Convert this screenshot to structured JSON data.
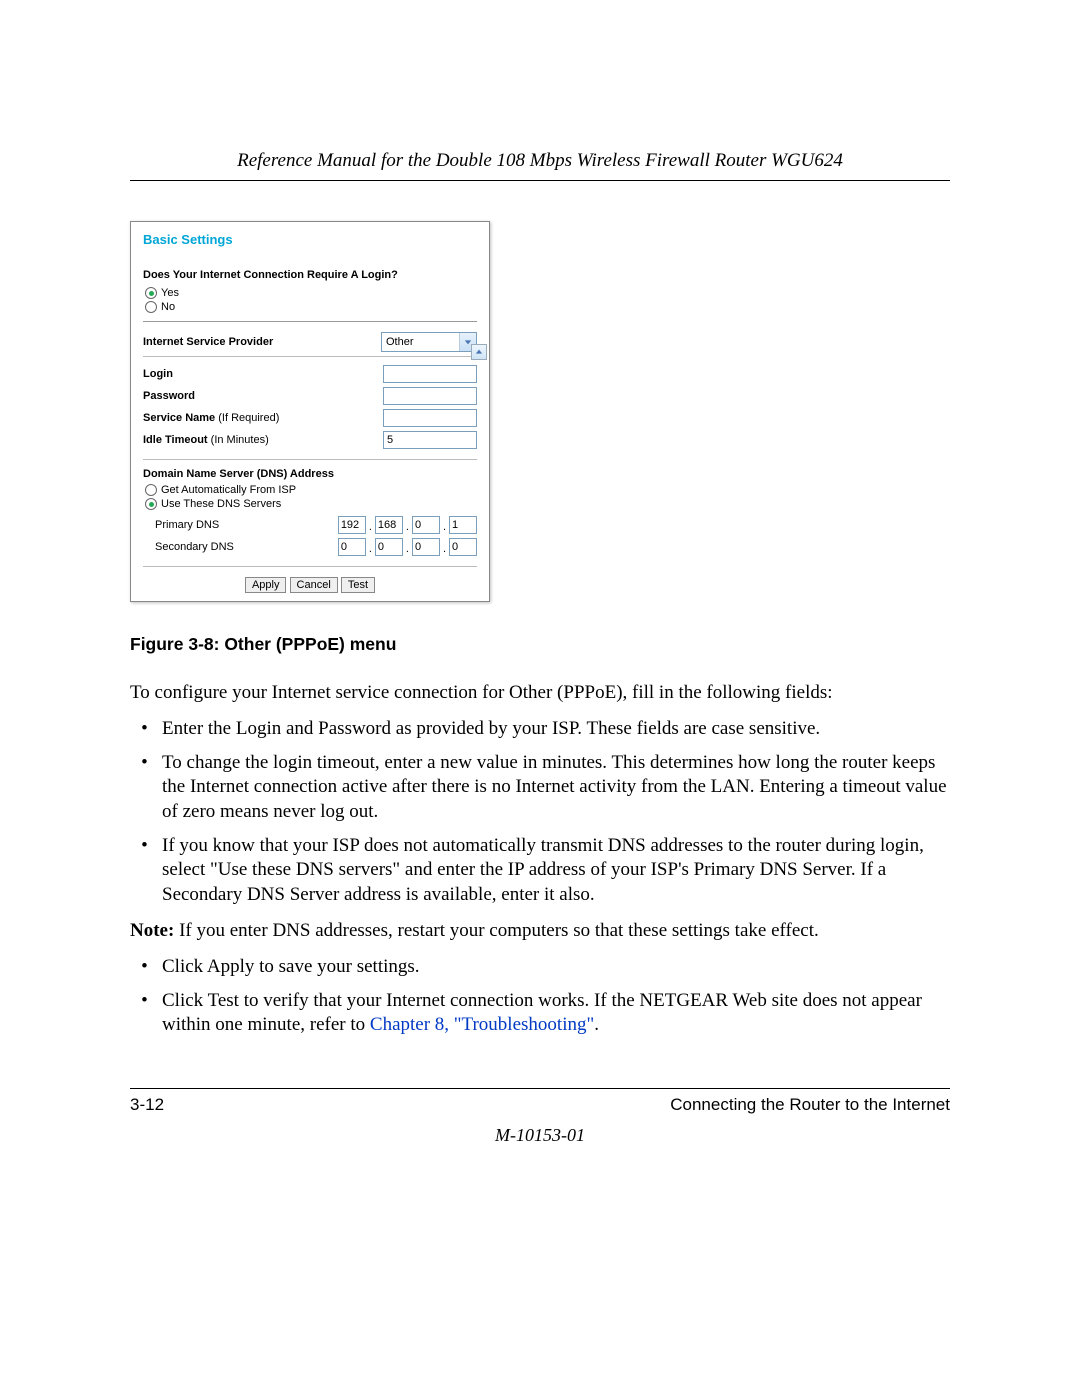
{
  "header": {
    "title": "Reference Manual for the Double 108 Mbps Wireless Firewall Router WGU624"
  },
  "screenshot": {
    "title": "Basic Settings",
    "question": "Does Your Internet Connection Require A Login?",
    "radio_yes": "Yes",
    "radio_no": "No",
    "isp_label": "Internet Service Provider",
    "isp_value": "Other",
    "login_label": "Login",
    "login_value": "",
    "password_label": "Password",
    "password_value": "",
    "service_label": "Service Name",
    "service_paren": "(If Required)",
    "service_value": "",
    "idle_label": "Idle Timeout",
    "idle_paren": "(In Minutes)",
    "idle_value": "5",
    "dns_header": "Domain Name Server (DNS) Address",
    "dns_auto": "Get Automatically From ISP",
    "dns_use": "Use These DNS Servers",
    "primary_label": "Primary DNS",
    "secondary_label": "Secondary DNS",
    "primary_ip": [
      "192",
      "168",
      "0",
      "1"
    ],
    "secondary_ip": [
      "0",
      "0",
      "0",
      "0"
    ],
    "btn_apply": "Apply",
    "btn_cancel": "Cancel",
    "btn_test": "Test"
  },
  "caption": "Figure 3-8:  Other (PPPoE) menu",
  "body": {
    "intro": "To configure your Internet service connection for Other (PPPoE), fill in the following fields:",
    "b1": "Enter the Login and Password as provided by your ISP. These fields are case sensitive.",
    "b2": "To change the login timeout, enter a new value in minutes. This determines how long the router keeps the Internet connection active after there is no Internet activity from the LAN. Entering a timeout value of zero means never log out.",
    "b3": "If you know that your ISP does not automatically transmit DNS addresses to the router during login, select \"Use these DNS servers\" and enter the IP address of your ISP's Primary DNS Server. If a Secondary DNS Server address is available, enter it also.",
    "note_bold": "Note:",
    "note": " If you enter DNS addresses, restart your computers so that these settings take effect.",
    "b4": "Click Apply to save your settings.",
    "b5_a": "Click Test to verify that your Internet connection works. If the NETGEAR Web site does not appear within one minute, refer to ",
    "b5_link": "Chapter 8, \"Troubleshooting\"",
    "b5_b": "."
  },
  "footer": {
    "page": "3-12",
    "section": "Connecting the Router to the Internet",
    "docid": "M-10153-01"
  }
}
